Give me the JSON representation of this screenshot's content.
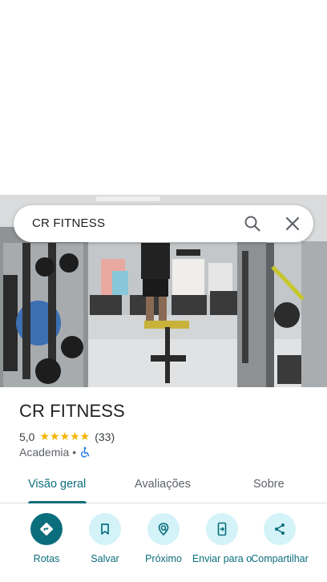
{
  "search": {
    "query": "CR FITNESS"
  },
  "place": {
    "name": "CR FITNESS",
    "rating": "5,0",
    "stars": "★★★★★",
    "review_count": "(33)",
    "category": "Academia",
    "separator": "•"
  },
  "tabs": [
    {
      "label": "Visão geral",
      "active": true
    },
    {
      "label": "Avaliações",
      "active": false
    },
    {
      "label": "Sobre",
      "active": false
    }
  ],
  "actions": [
    {
      "label": "Rotas",
      "icon": "directions-icon"
    },
    {
      "label": "Salvar",
      "icon": "bookmark-icon"
    },
    {
      "label": "Próximo",
      "icon": "nearby-icon"
    },
    {
      "label": "Enviar para o",
      "icon": "send-to-phone-icon"
    },
    {
      "label": "Compartilhar",
      "icon": "share-icon"
    }
  ],
  "colors": {
    "accent": "#0b6e7c",
    "accent_light": "#d3f3f8",
    "star": "#f4b400",
    "wheelchair": "#1a73e8"
  }
}
